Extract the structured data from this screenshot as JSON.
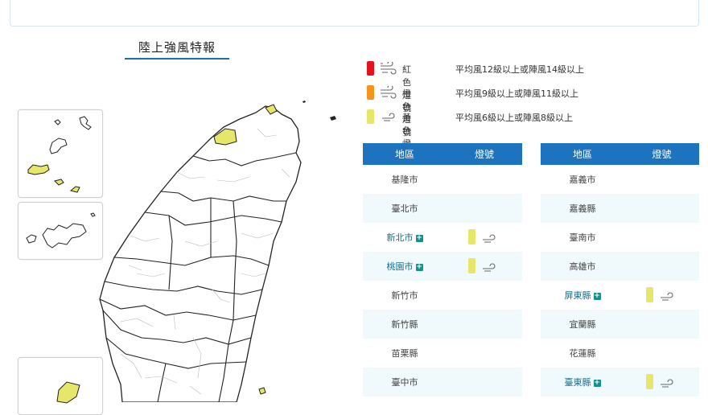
{
  "map": {
    "title": "陸上強風特報"
  },
  "legend": [
    {
      "name": "紅色燈號",
      "color": "#e8101c",
      "icon": "strong-wind-icon",
      "desc": "平均風12級以上或陣風14級以上"
    },
    {
      "name": "橙色燈號",
      "color": "#f7941d",
      "icon": "strong-wind-icon",
      "desc": "平均風9級以上或陣風11級以上"
    },
    {
      "name": "黃色燈號",
      "color": "#e6e66a",
      "icon": "wind-icon",
      "desc": "平均風6級以上或陣風8級以上"
    }
  ],
  "table": {
    "col_region": "地區",
    "col_signal": "燈號"
  },
  "regions_left": [
    {
      "name": "基隆市",
      "level": null
    },
    {
      "name": "臺北市",
      "level": null
    },
    {
      "name": "新北市",
      "level": "yellow"
    },
    {
      "name": "桃園市",
      "level": "yellow"
    },
    {
      "name": "新竹市",
      "level": null
    },
    {
      "name": "新竹縣",
      "level": null
    },
    {
      "name": "苗栗縣",
      "level": null
    },
    {
      "name": "臺中市",
      "level": null
    }
  ],
  "regions_right": [
    {
      "name": "嘉義市",
      "level": null
    },
    {
      "name": "嘉義縣",
      "level": null
    },
    {
      "name": "臺南市",
      "level": null
    },
    {
      "name": "高雄市",
      "level": null
    },
    {
      "name": "屏東縣",
      "level": "yellow"
    },
    {
      "name": "宜蘭縣",
      "level": null
    },
    {
      "name": "花蓮縣",
      "level": null
    },
    {
      "name": "臺東縣",
      "level": "yellow"
    }
  ],
  "colors": {
    "yellow": "#e6e66a",
    "header": "#1e73be",
    "map_fill": "#ffffff",
    "map_stroke": "#222222"
  }
}
